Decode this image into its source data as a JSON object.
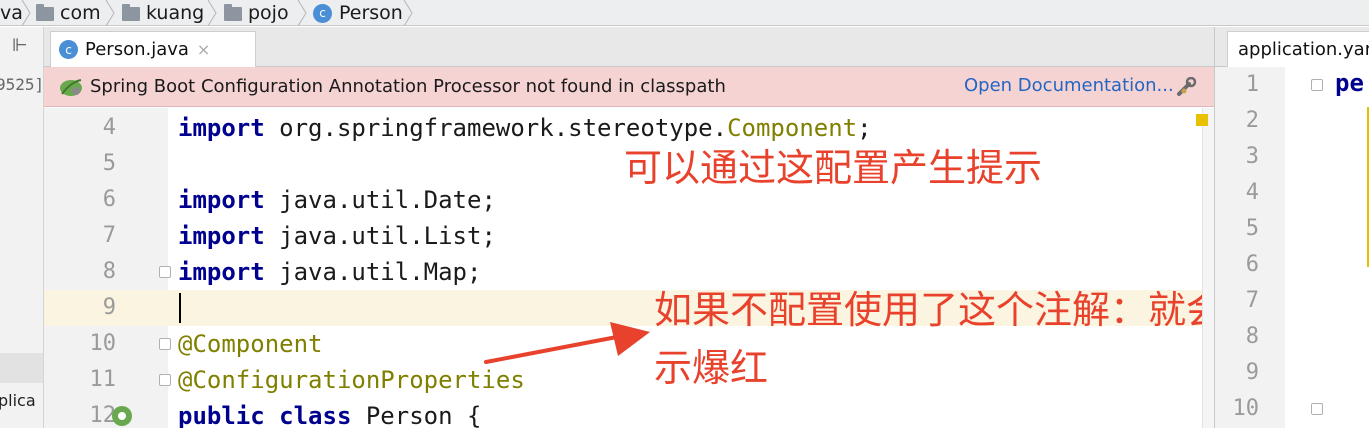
{
  "breadcrumb": {
    "items": [
      "va",
      "com",
      "kuang",
      "pojo",
      "Person"
    ]
  },
  "left_strip": {
    "pin_glyph": "⊩",
    "partial_text_top": "9525]",
    "partial_text_bottom": "plica"
  },
  "tabs": {
    "active": {
      "label": "Person.java",
      "icon": "class-icon",
      "close_glyph": "×"
    }
  },
  "banner": {
    "message": "Spring Boot Configuration Annotation Processor not found in classpath",
    "link": "Open Documentation...",
    "icon": "spring-leaf-icon",
    "settings_icon": "wrench-icon",
    "bg_color": "#f6d3d3",
    "link_color": "#2266c4"
  },
  "editor": {
    "lines": [
      {
        "num": "4",
        "kw": "import",
        "text": " org.springframework.stereotype.",
        "cls": "Component",
        "tail": ";"
      },
      {
        "num": "5",
        "kw": "",
        "text": "",
        "cls": "",
        "tail": ""
      },
      {
        "num": "6",
        "kw": "import",
        "text": " java.util.Date;",
        "cls": "",
        "tail": ""
      },
      {
        "num": "7",
        "kw": "import",
        "text": " java.util.List;",
        "cls": "",
        "tail": ""
      },
      {
        "num": "8",
        "kw": "import",
        "text": " java.util.Map;",
        "cls": "",
        "tail": ""
      },
      {
        "num": "9",
        "kw": "",
        "text": "",
        "cls": "",
        "tail": ""
      },
      {
        "num": "10",
        "ann": "@Component"
      },
      {
        "num": "11",
        "ann": "@ConfigurationProperties"
      },
      {
        "num": "12",
        "kw": "public class",
        "text": " Person {",
        "cls": "",
        "tail": ""
      }
    ],
    "current_line": "9"
  },
  "annotations": {
    "note1": "可以通过这配置产生提示",
    "note2_line1": "如果不配置使用了这个注解：就会提",
    "note2_line2": "示爆红",
    "color": "#e8412c"
  },
  "right_pane": {
    "tab_label": "application.yaml",
    "line_numbers": [
      "1",
      "2",
      "3",
      "4",
      "5",
      "6",
      "7",
      "8",
      "9",
      "10"
    ],
    "code_fragment": "pe"
  }
}
